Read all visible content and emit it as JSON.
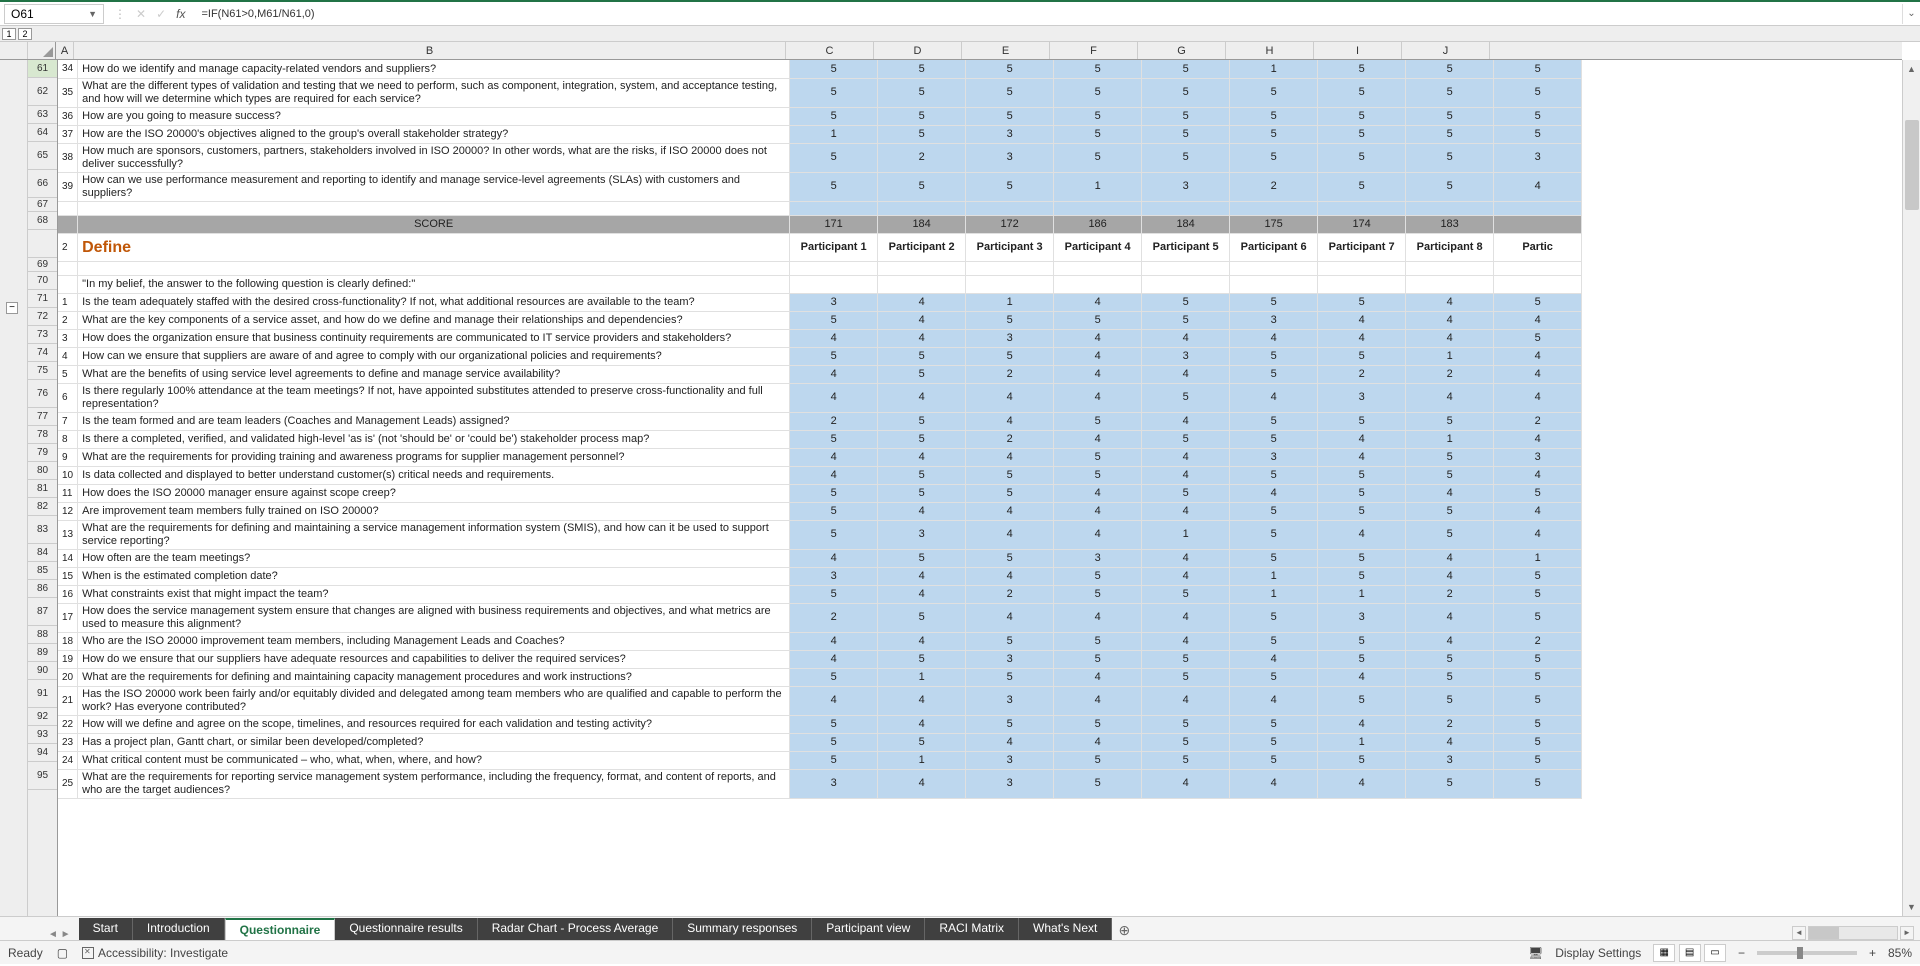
{
  "nameBox": "O61",
  "formula": "=IF(N61>0,M61/N61,0)",
  "outlineLevels": [
    "1",
    "2"
  ],
  "columns": [
    "A",
    "B",
    "C",
    "D",
    "E",
    "F",
    "G",
    "H",
    "I",
    "J"
  ],
  "colWidths": {
    "A": 18,
    "B": 712,
    "C": 88,
    "D": 88,
    "E": 88,
    "F": 88,
    "G": 88,
    "H": 88,
    "I": 88,
    "J": 88
  },
  "rowNumbers": [
    61,
    62,
    63,
    64,
    65,
    66,
    67,
    68,
    "",
    69,
    70,
    71,
    72,
    73,
    74,
    75,
    76,
    77,
    78,
    79,
    80,
    81,
    82,
    83,
    84,
    85,
    86,
    87,
    88,
    89,
    90,
    91,
    92,
    93,
    94,
    95
  ],
  "tallRows": [
    62,
    65,
    66,
    76,
    83,
    87,
    91,
    95
  ],
  "shortRows": [
    67
  ],
  "section1": [
    {
      "n": 34,
      "q": "How do we identify and manage capacity-related vendors and suppliers?",
      "v": [
        5,
        5,
        5,
        5,
        5,
        1,
        5,
        5,
        5
      ]
    },
    {
      "n": 35,
      "q": "What are the different types of validation and testing that we need to perform, such as component, integration, system, and acceptance testing, and how will we determine which types are required for each service?",
      "v": [
        5,
        5,
        5,
        5,
        5,
        5,
        5,
        5,
        5
      ],
      "tall": true
    },
    {
      "n": 36,
      "q": "How are you going to measure success?",
      "v": [
        5,
        5,
        5,
        5,
        5,
        5,
        5,
        5,
        5
      ]
    },
    {
      "n": 37,
      "q": "How are the ISO 20000's objectives aligned to the group's overall stakeholder strategy?",
      "v": [
        1,
        5,
        3,
        5,
        5,
        5,
        5,
        5,
        5
      ]
    },
    {
      "n": 38,
      "q": "How much are sponsors, customers, partners, stakeholders involved in ISO 20000? In other words, what are the risks, if ISO 20000 does not deliver successfully?",
      "v": [
        5,
        2,
        3,
        5,
        5,
        5,
        5,
        5,
        3
      ],
      "tall": true
    },
    {
      "n": 39,
      "q": "How can we use performance measurement and reporting to identify and manage service-level agreements (SLAs) with customers and suppliers?",
      "v": [
        5,
        5,
        5,
        1,
        3,
        2,
        5,
        5,
        4
      ],
      "tall": true
    }
  ],
  "scoreRow": {
    "label": "SCORE",
    "values": [
      171,
      184,
      172,
      186,
      184,
      175,
      174,
      183,
      ""
    ]
  },
  "defineHeader": {
    "n": 2,
    "label": "Define",
    "participants": [
      "Participant 1",
      "Participant 2",
      "Participant 3",
      "Participant 4",
      "Participant 5",
      "Participant 6",
      "Participant 7",
      "Participant 8",
      "Partic"
    ]
  },
  "beliefRow": "\"In my belief, the answer to the following question is clearly defined:\"",
  "section2": [
    {
      "n": 1,
      "q": "Is the team adequately staffed with the desired cross-functionality? If not, what additional resources are available to the team?",
      "v": [
        3,
        4,
        1,
        4,
        5,
        5,
        5,
        4,
        5
      ]
    },
    {
      "n": 2,
      "q": "What are the key components of a service asset, and how do we define and manage their relationships and dependencies?",
      "v": [
        5,
        4,
        5,
        5,
        5,
        3,
        4,
        4,
        4
      ]
    },
    {
      "n": 3,
      "q": "How does the organization ensure that business continuity requirements are communicated to IT service providers and stakeholders?",
      "v": [
        4,
        4,
        3,
        4,
        4,
        4,
        4,
        4,
        5
      ]
    },
    {
      "n": 4,
      "q": "How can we ensure that suppliers are aware of and agree to comply with our organizational policies and requirements?",
      "v": [
        5,
        5,
        5,
        4,
        3,
        5,
        5,
        1,
        4
      ]
    },
    {
      "n": 5,
      "q": "What are the benefits of using service level agreements to define and manage service availability?",
      "v": [
        4,
        5,
        2,
        4,
        4,
        5,
        2,
        2,
        4
      ]
    },
    {
      "n": 6,
      "q": "Is there regularly 100% attendance at the team meetings? If not, have appointed substitutes attended to preserve cross-functionality and full representation?",
      "v": [
        4,
        4,
        4,
        4,
        5,
        4,
        3,
        4,
        4
      ],
      "tall": true
    },
    {
      "n": 7,
      "q": "Is the team formed and are team leaders (Coaches and Management Leads) assigned?",
      "v": [
        2,
        5,
        4,
        5,
        4,
        5,
        5,
        5,
        2
      ]
    },
    {
      "n": 8,
      "q": "Is there a completed, verified, and validated high-level 'as is' (not 'should be' or 'could be') stakeholder process map?",
      "v": [
        5,
        5,
        2,
        4,
        5,
        5,
        4,
        1,
        4
      ]
    },
    {
      "n": 9,
      "q": "What are the requirements for providing training and awareness programs for supplier management personnel?",
      "v": [
        4,
        4,
        4,
        5,
        4,
        3,
        4,
        5,
        3
      ]
    },
    {
      "n": 10,
      "q": "Is data collected and displayed to better understand customer(s) critical needs and requirements.",
      "v": [
        4,
        5,
        5,
        5,
        4,
        5,
        5,
        5,
        4
      ]
    },
    {
      "n": 11,
      "q": "How does the ISO 20000 manager ensure against scope creep?",
      "v": [
        5,
        5,
        5,
        4,
        5,
        4,
        5,
        4,
        5
      ]
    },
    {
      "n": 12,
      "q": "Are improvement team members fully trained on ISO 20000?",
      "v": [
        5,
        4,
        4,
        4,
        4,
        5,
        5,
        5,
        4
      ]
    },
    {
      "n": 13,
      "q": "What are the requirements for defining and maintaining a service management information system (SMIS), and how can it be used to support service reporting?",
      "v": [
        5,
        3,
        4,
        4,
        1,
        5,
        4,
        5,
        4
      ],
      "tall": true
    },
    {
      "n": 14,
      "q": "How often are the team meetings?",
      "v": [
        4,
        5,
        5,
        3,
        4,
        5,
        5,
        4,
        1
      ]
    },
    {
      "n": 15,
      "q": "When is the estimated completion date?",
      "v": [
        3,
        4,
        4,
        5,
        4,
        1,
        5,
        4,
        5
      ]
    },
    {
      "n": 16,
      "q": "What constraints exist that might impact the team?",
      "v": [
        5,
        4,
        2,
        5,
        5,
        1,
        1,
        2,
        5
      ]
    },
    {
      "n": 17,
      "q": "How does the service management system ensure that changes are aligned with business requirements and objectives, and what metrics are used to measure this alignment?",
      "v": [
        2,
        5,
        4,
        4,
        4,
        5,
        3,
        4,
        5
      ],
      "tall": true
    },
    {
      "n": 18,
      "q": "Who are the ISO 20000 improvement team members, including Management Leads and Coaches?",
      "v": [
        4,
        4,
        5,
        5,
        4,
        5,
        5,
        4,
        2
      ]
    },
    {
      "n": 19,
      "q": "How do we ensure that our suppliers have adequate resources and capabilities to deliver the required services?",
      "v": [
        4,
        5,
        3,
        5,
        5,
        4,
        5,
        5,
        5
      ]
    },
    {
      "n": 20,
      "q": "What are the requirements for defining and maintaining capacity management procedures and work instructions?",
      "v": [
        5,
        1,
        5,
        4,
        5,
        5,
        4,
        5,
        5
      ]
    },
    {
      "n": 21,
      "q": "Has the ISO 20000 work been fairly and/or equitably divided and delegated among team members who are qualified and capable to perform the work? Has everyone contributed?",
      "v": [
        4,
        4,
        3,
        4,
        4,
        4,
        5,
        5,
        5
      ],
      "tall": true
    },
    {
      "n": 22,
      "q": "How will we define and agree on the scope, timelines, and resources required for each validation and testing activity?",
      "v": [
        5,
        4,
        5,
        5,
        5,
        5,
        4,
        2,
        5
      ]
    },
    {
      "n": 23,
      "q": "Has a project plan, Gantt chart, or similar been developed/completed?",
      "v": [
        5,
        5,
        4,
        4,
        5,
        5,
        1,
        4,
        5
      ]
    },
    {
      "n": 24,
      "q": "What critical content must be communicated – who, what, when, where, and how?",
      "v": [
        5,
        1,
        3,
        5,
        5,
        5,
        5,
        3,
        5
      ]
    },
    {
      "n": 25,
      "q": "What are the requirements for reporting service management system performance, including the frequency, format, and content of reports, and who are the target audiences?",
      "v": [
        3,
        4,
        3,
        5,
        4,
        4,
        4,
        5,
        5
      ],
      "tall": true
    }
  ],
  "tabs": [
    "Start",
    "Introduction",
    "Questionnaire",
    "Questionnaire results",
    "Radar Chart - Process Average",
    "Summary responses",
    "Participant view",
    "RACI Matrix",
    "What's Next"
  ],
  "activeTab": 2,
  "status": {
    "ready": "Ready",
    "accessibility": "Accessibility: Investigate",
    "display": "Display Settings",
    "zoom": "85%"
  }
}
